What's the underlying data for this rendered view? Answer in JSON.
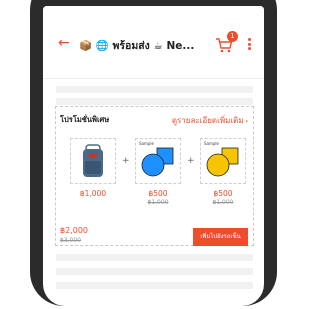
{
  "header": {
    "title": "📦 🌐 พร้อมส่ง ☕ Ne...",
    "cart_count": "1"
  },
  "bundle": {
    "title": "โปรโมชั่นพิเศษ",
    "link_label": "ดูรายละเอียดเพิ่มเติม",
    "items": [
      {
        "price": "฿1,000",
        "original_price": ""
      },
      {
        "tag": "Sample",
        "price": "฿500",
        "original_price": "฿1,000"
      },
      {
        "tag": "Sample",
        "price": "฿500",
        "original_price": "฿1,000"
      }
    ],
    "total": "฿2,000",
    "total_original": "฿3,000",
    "add_button": "เพิ่มไปยังรถเข็น"
  },
  "colors": {
    "accent": "#ee4d2d",
    "product2_circle": "#1e90ff",
    "product3_circle": "#f6c500"
  }
}
